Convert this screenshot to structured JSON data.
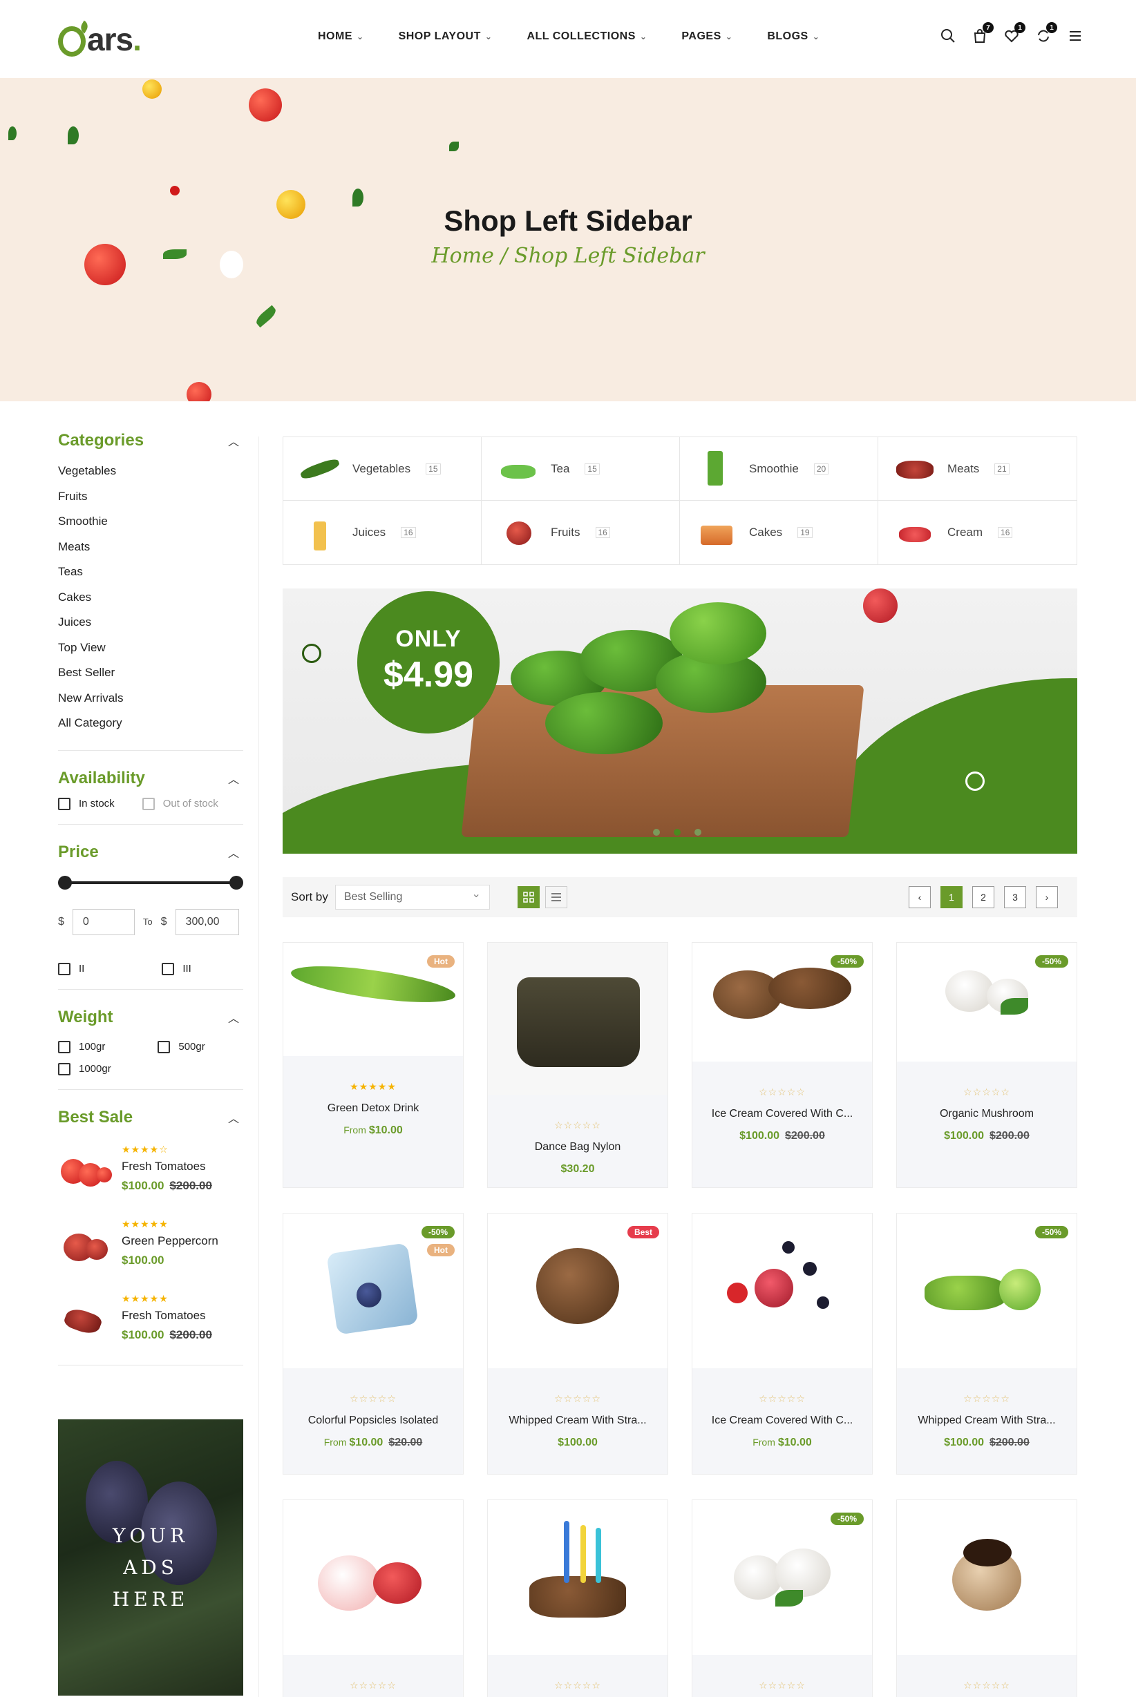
{
  "header": {
    "logo_text": "ars",
    "logo_dot": ".",
    "nav": [
      {
        "label": "HOME"
      },
      {
        "label": "SHOP LAYOUT"
      },
      {
        "label": "ALL COLLECTIONS"
      },
      {
        "label": "PAGES"
      },
      {
        "label": "BLOGS"
      }
    ],
    "badges": {
      "cart": "7",
      "wishlist": "1",
      "compare": "1"
    }
  },
  "hero": {
    "title": "Shop Left Sidebar",
    "breadcrumb": "Home / Shop Left Sidebar"
  },
  "sidebar": {
    "categories": {
      "title": "Categories",
      "items": [
        "Vegetables",
        "Fruits",
        "Smoothie",
        "Meats",
        "Teas",
        "Cakes",
        "Juices",
        "Top View",
        "Best Seller",
        "New Arrivals",
        "All Category"
      ]
    },
    "availability": {
      "title": "Availability",
      "options": [
        "In stock",
        "Out of stock"
      ]
    },
    "price": {
      "title": "Price",
      "currency": "$",
      "to_label": "To",
      "min": "0",
      "max": "300,00",
      "extra_label": "",
      "extra_options": [
        "II",
        "III"
      ]
    },
    "weight": {
      "title": "Weight",
      "options": [
        "100gr",
        "500gr",
        "1000gr"
      ]
    },
    "best_sale": {
      "title": "Best Sale",
      "items": [
        {
          "name": "Fresh Tomatoes",
          "price": "$100.00",
          "old": "$200.00",
          "stars": "★★★★☆"
        },
        {
          "name": "Green Peppercorn",
          "price": "$100.00",
          "old": "",
          "stars": "★★★★★"
        },
        {
          "name": "Fresh Tomatoes",
          "price": "$100.00",
          "old": "$200.00",
          "stars": "★★★★★"
        }
      ]
    },
    "ads": [
      "YOUR",
      "ADS",
      "HERE"
    ]
  },
  "category_grid": [
    {
      "name": "Vegetables",
      "count": "15"
    },
    {
      "name": "Tea",
      "count": "15"
    },
    {
      "name": "Smoothie",
      "count": "20"
    },
    {
      "name": "Meats",
      "count": "21"
    },
    {
      "name": "Juices",
      "count": "16"
    },
    {
      "name": "Fruits",
      "count": "16"
    },
    {
      "name": "Cakes",
      "count": "19"
    },
    {
      "name": "Cream",
      "count": "16"
    }
  ],
  "banner": {
    "only": "ONLY",
    "amount": "$4.99"
  },
  "toolbar": {
    "sort_label": "Sort by",
    "sort_value": "Best Selling",
    "pages": [
      "1",
      "2",
      "3"
    ]
  },
  "products": [
    {
      "name": "Green Detox Drink",
      "from": "From",
      "price": "$10.00",
      "old": "",
      "tag": "Hot",
      "stars": "★★★★★"
    },
    {
      "name": "Dance Bag Nylon",
      "from": "",
      "price": "$30.20",
      "old": "",
      "tag": "",
      "stars": "☆☆☆☆☆"
    },
    {
      "name": "Ice Cream Covered With C...",
      "from": "",
      "price": "$100.00",
      "old": "$200.00",
      "tag": "-50%",
      "stars": "☆☆☆☆☆"
    },
    {
      "name": "Organic Mushroom",
      "from": "",
      "price": "$100.00",
      "old": "$200.00",
      "tag": "-50%",
      "stars": "☆☆☆☆☆"
    },
    {
      "name": "Colorful Popsicles Isolated",
      "from": "From",
      "price": "$10.00",
      "old": "$20.00",
      "tag": "-50%",
      "tag2": "Hot",
      "stars": "☆☆☆☆☆"
    },
    {
      "name": "Whipped Cream With Stra...",
      "from": "",
      "price": "$100.00",
      "old": "",
      "tag": "Best",
      "stars": "☆☆☆☆☆"
    },
    {
      "name": "Ice Cream Covered With C...",
      "from": "From",
      "price": "$10.00",
      "old": "",
      "tag": "",
      "stars": "☆☆☆☆☆"
    },
    {
      "name": "Whipped Cream With Stra...",
      "from": "",
      "price": "$100.00",
      "old": "$200.00",
      "tag": "-50%",
      "stars": "☆☆☆☆☆"
    },
    {
      "name": "",
      "from": "",
      "price": "",
      "old": "",
      "tag": "",
      "stars": "☆☆☆☆☆"
    },
    {
      "name": "",
      "from": "",
      "price": "",
      "old": "",
      "tag": "",
      "stars": "☆☆☆☆☆"
    },
    {
      "name": "",
      "from": "",
      "price": "",
      "old": "",
      "tag": "-50%",
      "stars": "☆☆☆☆☆"
    },
    {
      "name": "",
      "from": "",
      "price": "",
      "old": "",
      "tag": "",
      "stars": "☆☆☆☆☆"
    }
  ],
  "colors": {
    "accent": "#6a9b2a",
    "hero_bg": "#f8ece1",
    "sale_tag": "#6a9b2a",
    "hot_tag": "#e9b27f",
    "best_tag": "#e63c4c"
  }
}
